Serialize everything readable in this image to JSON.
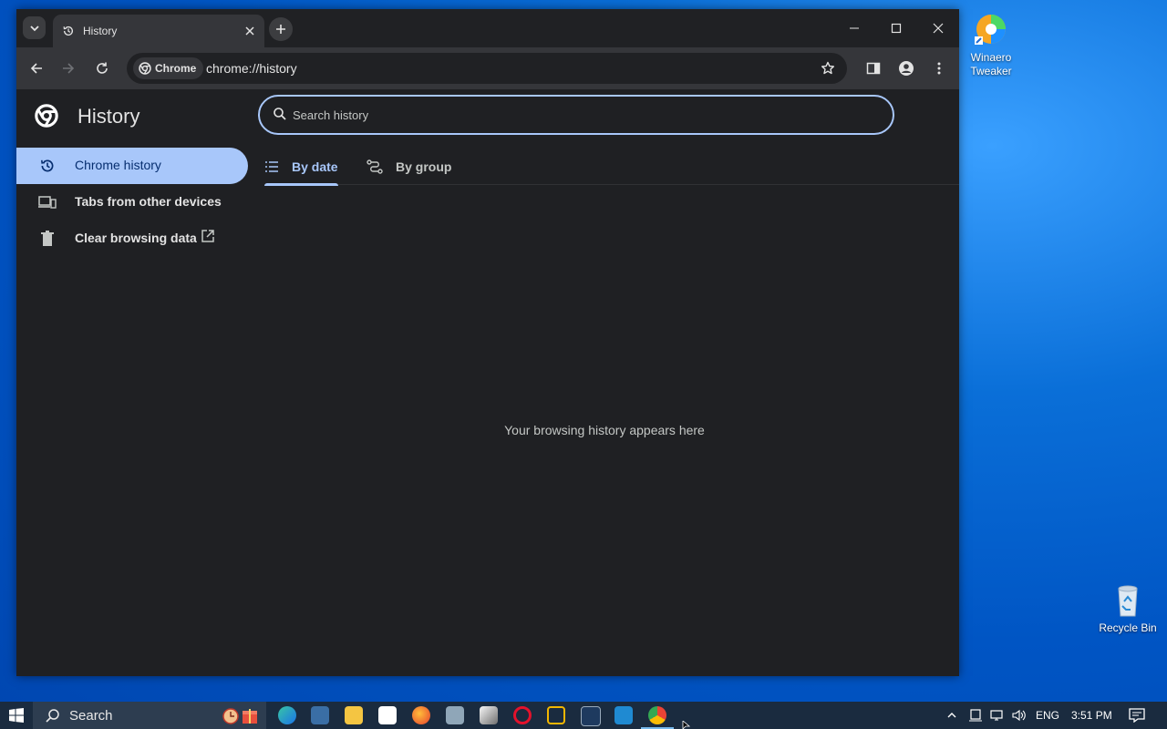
{
  "desktop": {
    "icons": [
      {
        "label": "Winaero Tweaker"
      },
      {
        "label": "Recycle Bin"
      }
    ]
  },
  "browser": {
    "tab": {
      "title": "History"
    },
    "omnibox": {
      "chip_label": "Chrome",
      "url": "chrome://history"
    },
    "colors": {
      "accent": "#a8c7fa",
      "background": "#1f2023"
    }
  },
  "history_page": {
    "title": "History",
    "search": {
      "placeholder": "Search history",
      "value": ""
    },
    "nav": [
      {
        "label": "Chrome history",
        "active": true
      },
      {
        "label": "Tabs from other devices",
        "active": false
      },
      {
        "label": "Clear browsing data",
        "active": false
      }
    ],
    "view_tabs": [
      {
        "label": "By date",
        "selected": true
      },
      {
        "label": "By group",
        "selected": false
      }
    ],
    "empty_message": "Your browsing history appears here"
  },
  "taskbar": {
    "search_label": "Search",
    "language": "ENG",
    "clock": "3:51 PM"
  }
}
